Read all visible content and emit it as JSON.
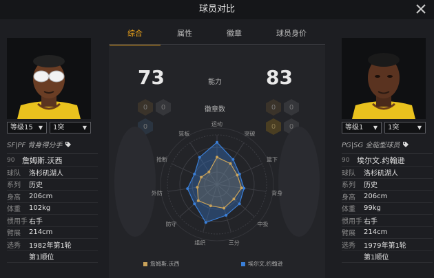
{
  "title": "球员对比",
  "tabs": [
    {
      "label": "综合",
      "active": true
    },
    {
      "label": "属性",
      "active": false
    },
    {
      "label": "徽章",
      "active": false
    },
    {
      "label": "球员身价",
      "active": false
    }
  ],
  "left_player": {
    "level": "等级15",
    "type": "1突",
    "position": "SF|PF 背身得分手",
    "overall": "90",
    "name": "詹姆斯.沃西",
    "rows": [
      {
        "k": "球队",
        "v": "洛杉矶湖人"
      },
      {
        "k": "系列",
        "v": "历史"
      },
      {
        "k": "身高",
        "v": "206cm"
      },
      {
        "k": "体重",
        "v": "102kg"
      },
      {
        "k": "惯用手",
        "v": "右手"
      },
      {
        "k": "臂展",
        "v": "214cm"
      },
      {
        "k": "选秀",
        "v": "1982年第1轮"
      },
      {
        "k": "",
        "v": "第1顺位"
      }
    ],
    "ability": "73",
    "badges": [
      "0",
      "0",
      "0"
    ]
  },
  "right_player": {
    "level": "等级1",
    "type": "1突",
    "position": "PG|SG 全能型球员",
    "overall": "90",
    "name": "埃尔文.约翰逊",
    "rows": [
      {
        "k": "球队",
        "v": "洛杉矶湖人"
      },
      {
        "k": "系列",
        "v": "历史"
      },
      {
        "k": "身高",
        "v": "206cm"
      },
      {
        "k": "体重",
        "v": "99kg"
      },
      {
        "k": "惯用手",
        "v": "右手"
      },
      {
        "k": "臂展",
        "v": "214cm"
      },
      {
        "k": "选秀",
        "v": "1979年第1轮"
      },
      {
        "k": "",
        "v": "第1顺位"
      }
    ],
    "ability": "83",
    "badges": [
      "0",
      "0",
      "0",
      "0"
    ]
  },
  "compare": {
    "ability_label": "能力",
    "badges_label": "徽章数"
  },
  "radar": {
    "axes": [
      "运动",
      "突破",
      "篮下",
      "背身",
      "中投",
      "三分",
      "组织",
      "防守",
      "外防",
      "抢断",
      "篮板"
    ],
    "left_values": [
      0.55,
      0.5,
      0.45,
      0.5,
      0.45,
      0.5,
      0.45,
      0.5,
      0.4,
      0.35,
      0.3
    ],
    "right_values": [
      0.85,
      0.6,
      0.5,
      0.55,
      0.6,
      0.65,
      0.8,
      0.6,
      0.6,
      0.5,
      0.65
    ]
  },
  "legend": {
    "left": "詹姆斯.沃西",
    "right": "埃尔文.约翰逊"
  },
  "colors": {
    "accent": "#f0a51a",
    "left_series": "#c9a25a",
    "right_series": "#3a7fd8"
  }
}
